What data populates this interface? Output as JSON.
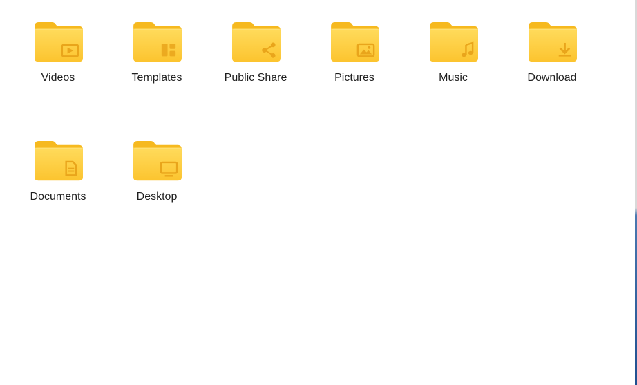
{
  "folders": [
    {
      "name": "Videos",
      "icon": "video-icon"
    },
    {
      "name": "Templates",
      "icon": "templates-icon"
    },
    {
      "name": "Public Share",
      "icon": "share-icon"
    },
    {
      "name": "Pictures",
      "icon": "picture-icon"
    },
    {
      "name": "Music",
      "icon": "music-icon"
    },
    {
      "name": "Download",
      "icon": "download-icon"
    },
    {
      "name": "Documents",
      "icon": "document-icon"
    },
    {
      "name": "Desktop",
      "icon": "desktop-icon"
    }
  ],
  "colors": {
    "folder_back": "#f8be27",
    "folder_front": "#ffd44d",
    "emblem": "#e9a51b",
    "label_text": "#1f1f1f"
  }
}
